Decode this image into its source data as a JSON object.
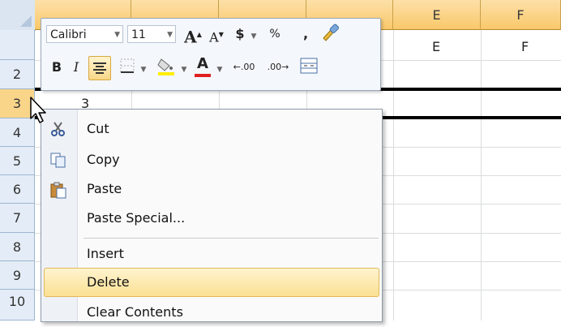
{
  "columns": [
    "",
    "",
    "",
    "",
    "E",
    "F"
  ],
  "rows": [
    "",
    "2",
    "3",
    "4",
    "5",
    "6",
    "7",
    "8",
    "9",
    "10"
  ],
  "cells": {
    "E1": "E",
    "F1": "F",
    "B3": "3"
  },
  "mini_toolbar": {
    "font_name": "Calibri",
    "font_size": "11",
    "grow_font": "A",
    "shrink_font": "A",
    "currency": "$",
    "percent": "%",
    "comma": ",",
    "bold": "B",
    "italic": "I",
    "font_color_letter": "A",
    "increase_decimal": ".00",
    "decrease_decimal": ".00"
  },
  "context_menu": {
    "items": [
      {
        "label": "Cut",
        "icon": "scissors-icon"
      },
      {
        "label": "Copy",
        "icon": "copy-icon"
      },
      {
        "label": "Paste",
        "icon": "paste-icon"
      },
      {
        "label": "Paste Special...",
        "icon": ""
      },
      {
        "label": "Insert",
        "icon": ""
      },
      {
        "label": "Delete",
        "icon": "",
        "highlighted": true
      },
      {
        "label": "Clear Contents",
        "icon": ""
      }
    ]
  },
  "colors": {
    "selected_header": "#f9c86a",
    "menu_highlight": "#fbe093",
    "font_color_bar": "#e02020",
    "fill_color_bar": "#ffee00"
  }
}
